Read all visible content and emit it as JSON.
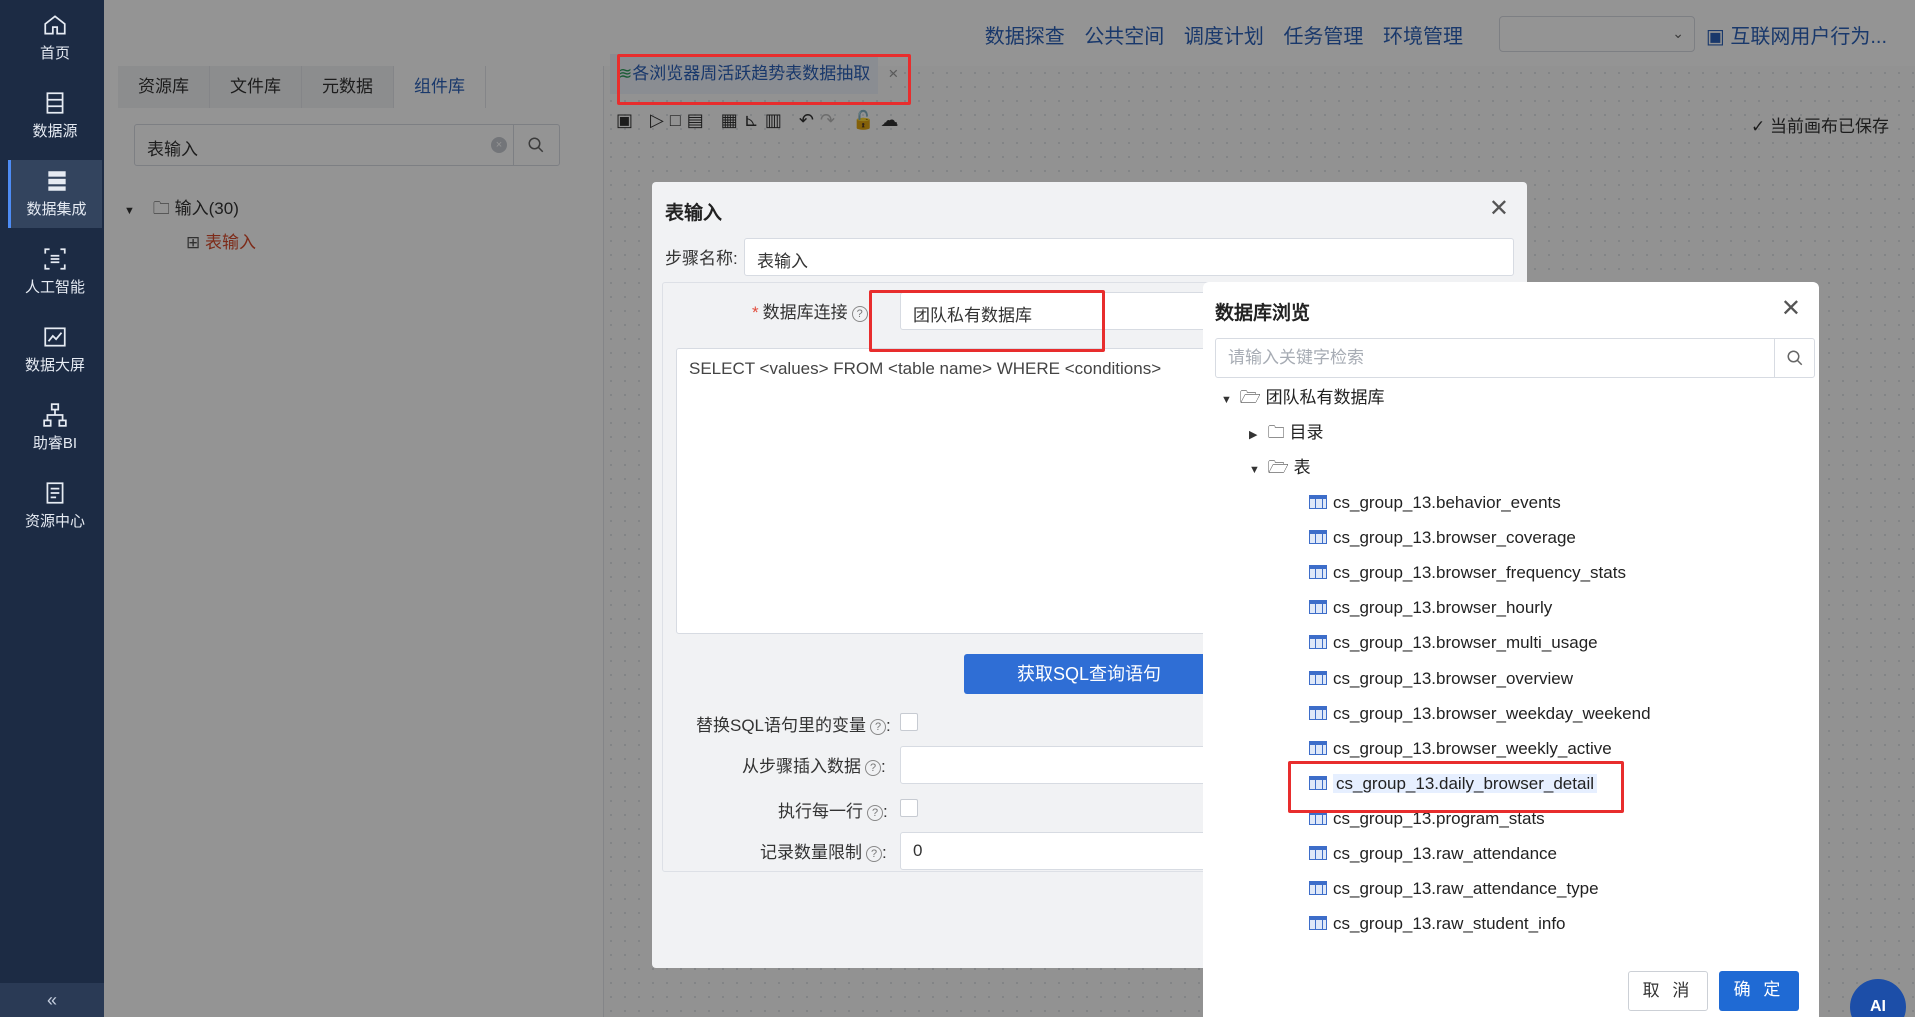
{
  "sidebar": {
    "items": [
      {
        "label": "首页",
        "icon": "home-icon"
      },
      {
        "label": "数据源",
        "icon": "database-icon"
      },
      {
        "label": "数据集成",
        "icon": "server-stack-icon",
        "active": true
      },
      {
        "label": "人工智能",
        "icon": "ai-scan-icon"
      },
      {
        "label": "数据大屏",
        "icon": "chart-line-icon"
      },
      {
        "label": "助睿BI",
        "icon": "org-chart-icon"
      },
      {
        "label": "资源中心",
        "icon": "document-icon"
      }
    ],
    "collapse": "«"
  },
  "topnav": {
    "links": [
      "数据探查",
      "公共空间",
      "调度计划",
      "任务管理",
      "环境管理"
    ],
    "select_value": "",
    "app_name": "互联网用户行为..."
  },
  "library": {
    "tabs": [
      "资源库",
      "文件库",
      "元数据",
      "组件库"
    ],
    "active_tab": "组件库",
    "search_value": "表输入",
    "tree_root": "输入(30)",
    "tree_child": "表输入"
  },
  "canvas": {
    "doc_tab": "各浏览器周活跃趋势表数据抽取",
    "doc_tab_close": "×",
    "saved_status": "当前画布已保存"
  },
  "table_input_dialog": {
    "title": "表输入",
    "step_name_label": "步骤名称:",
    "step_name_value": "表输入",
    "db_conn_label": "数据库连接",
    "db_conn_value": "团队私有数据库",
    "sql_value": "SELECT <values> FROM <table name> WHERE <conditions>",
    "get_sql_button": "获取SQL查询语句",
    "replace_vars_label": "替换SQL语句里的变量",
    "insert_from_step_label": "从步骤插入数据",
    "exec_each_row_label": "执行每一行",
    "row_limit_label": "记录数量限制",
    "row_limit_value": "0"
  },
  "db_browser": {
    "title": "数据库浏览",
    "search_placeholder": "请输入关键字检索",
    "root": "团队私有数据库",
    "folder_catalog": "目录",
    "folder_tables": "表",
    "tables": [
      "cs_group_13.behavior_events",
      "cs_group_13.browser_coverage",
      "cs_group_13.browser_frequency_stats",
      "cs_group_13.browser_hourly",
      "cs_group_13.browser_multi_usage",
      "cs_group_13.browser_overview",
      "cs_group_13.browser_weekday_weekend",
      "cs_group_13.browser_weekly_active",
      "cs_group_13.daily_browser_detail",
      "cs_group_13.program_stats",
      "cs_group_13.raw_attendance",
      "cs_group_13.raw_attendance_type",
      "cs_group_13.raw_student_info"
    ],
    "selected_table": "cs_group_13.daily_browser_detail",
    "cancel": "取 消",
    "ok": "确 定"
  },
  "ai_button": "AI",
  "colors": {
    "accent": "#2f6ed5",
    "highlight": "#e82d2d",
    "sidebar": "#1c2b44"
  }
}
